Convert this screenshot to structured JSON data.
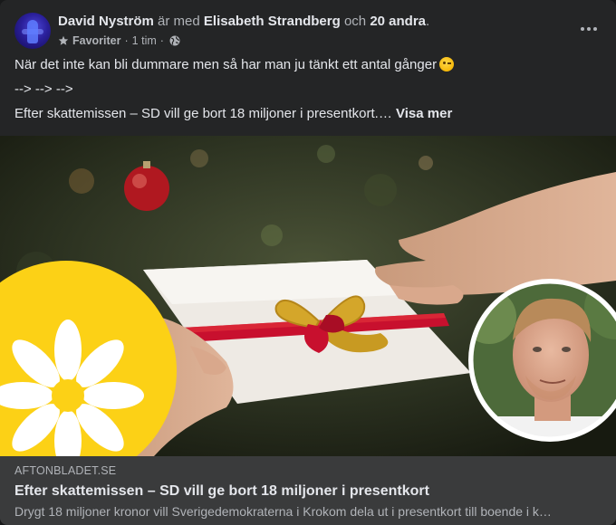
{
  "post": {
    "author": "David Nyström",
    "with_text": "är med",
    "tagged_person": "Elisabeth Strandberg",
    "and_text": "och",
    "others": "20 andra",
    "end_punct": ".",
    "audience": "Favoriter",
    "dot1": "·",
    "time": "1 tim",
    "dot2": "·",
    "more_icon": "ellipsis-icon",
    "line1": "När det inte kan bli dummare men så har man ju tänkt ett antal gånger",
    "line1_emoji": "winking-face-emoji",
    "line2": "--> --> -->",
    "line3": "Efter skattemissen – SD vill ge bort 18 miljoner i presentkort.…",
    "see_more": "Visa mer"
  },
  "link": {
    "domain": "AFTONBLADET.SE",
    "title": "Efter skattemissen – SD vill ge bort 18 miljoner i presentkort",
    "description": "Drygt 18 miljoner kronor vill Sverigedemokraterna i Krokom dela ut i presentkort till boende i k…"
  },
  "colors": {
    "card_bg": "#242526",
    "footer_bg": "#3a3b3c",
    "primary_text": "#e4e6eb",
    "secondary_text": "#b0b3b8",
    "sd_yellow": "#fcd116",
    "ribbon_red": "#c8102e"
  }
}
